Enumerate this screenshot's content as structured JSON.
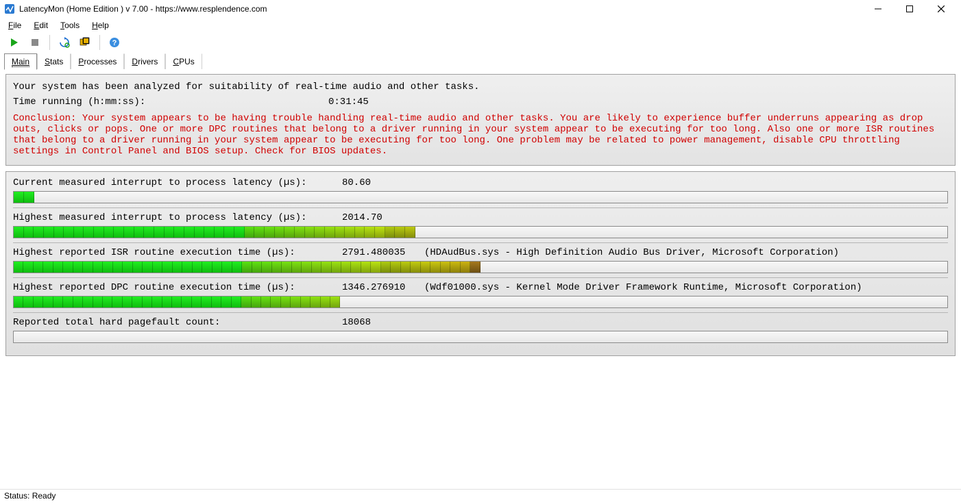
{
  "window": {
    "title": "LatencyMon  (Home Edition )  v 7.00 -  https://www.resplendence.com"
  },
  "menu": {
    "file": "File",
    "edit": "Edit",
    "tools": "Tools",
    "help": "Help"
  },
  "tabs": {
    "main": "Main",
    "stats": "Stats",
    "processes": "Processes",
    "drivers": "Drivers",
    "cpus": "CPUs"
  },
  "analysis": {
    "line1": "Your system has been analyzed for suitability of real-time audio and other tasks.",
    "time_label": "Time running (h:mm:ss):",
    "time_value": "0:31:45",
    "conclusion": "Conclusion: Your system appears to be having trouble handling real-time audio and other tasks. You are likely to experience buffer underruns appearing as drop outs, clicks or pops. One or more DPC routines that belong to a driver running in your system appear to be executing for too long. Also one or more ISR routines that belong to a driver running in your system appear to be executing for too long. One problem may be related to power management, disable CPU throttling settings in Control Panel and BIOS setup. Check for BIOS updates."
  },
  "metrics": {
    "current_latency": {
      "label": "Current measured interrupt to process latency (µs):",
      "value": "80.60",
      "fill_percent": 2.2,
      "segments": 2
    },
    "highest_latency": {
      "label": "Highest measured interrupt to process latency (µs):",
      "value": "2014.70",
      "fill_percent": 43,
      "segments": 40
    },
    "highest_isr": {
      "label": "Highest reported ISR routine execution time (µs):",
      "value": "2791.480035",
      "extra": "(HDAudBus.sys - High Definition Audio Bus Driver, Microsoft Corporation)",
      "fill_percent": 50,
      "segments": 47
    },
    "highest_dpc": {
      "label": "Highest reported DPC routine execution time (µs):",
      "value": "1346.276910",
      "extra": "(Wdf01000.sys - Kernel Mode Driver Framework Runtime, Microsoft Corporation)",
      "fill_percent": 35,
      "segments": 33
    },
    "pagefault": {
      "label": "Reported total hard pagefault count:",
      "value": "18068",
      "fill_percent": 0,
      "segments": 0
    }
  },
  "status": {
    "text": "Status: Ready"
  }
}
